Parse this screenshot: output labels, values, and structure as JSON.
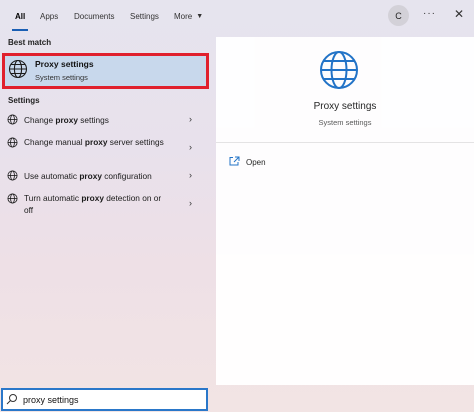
{
  "tabs": [
    {
      "label": "All"
    },
    {
      "label": "Apps"
    },
    {
      "label": "Documents"
    },
    {
      "label": "Settings"
    },
    {
      "label": "More"
    }
  ],
  "header": {
    "avatar_initial": "C",
    "more_options": "···",
    "close": "✕"
  },
  "best_match": {
    "heading": "Best match",
    "title": "Proxy settings",
    "subtitle": "System settings",
    "icon": "globe-icon"
  },
  "settings_section": {
    "heading": "Settings",
    "items": [
      {
        "pre": "Change ",
        "bold": "proxy",
        "post": " settings"
      },
      {
        "pre": "Change manual ",
        "bold": "proxy",
        "post": " server settings"
      },
      {
        "pre": "Use automatic ",
        "bold": "proxy",
        "post": " configuration"
      },
      {
        "pre": "Turn automatic ",
        "bold": "proxy",
        "post": " detection on or off"
      }
    ]
  },
  "details": {
    "title": "Proxy settings",
    "subtitle": "System settings",
    "actions": [
      {
        "label": "Open",
        "icon": "open-window-icon"
      }
    ]
  },
  "search": {
    "value": "proxy settings",
    "icon": "search-icon"
  },
  "colors": {
    "accent": "#2a77c9",
    "highlight_border": "#e0202d",
    "selected_bg": "#c8d8ec",
    "globe": "#1a6fc6"
  }
}
